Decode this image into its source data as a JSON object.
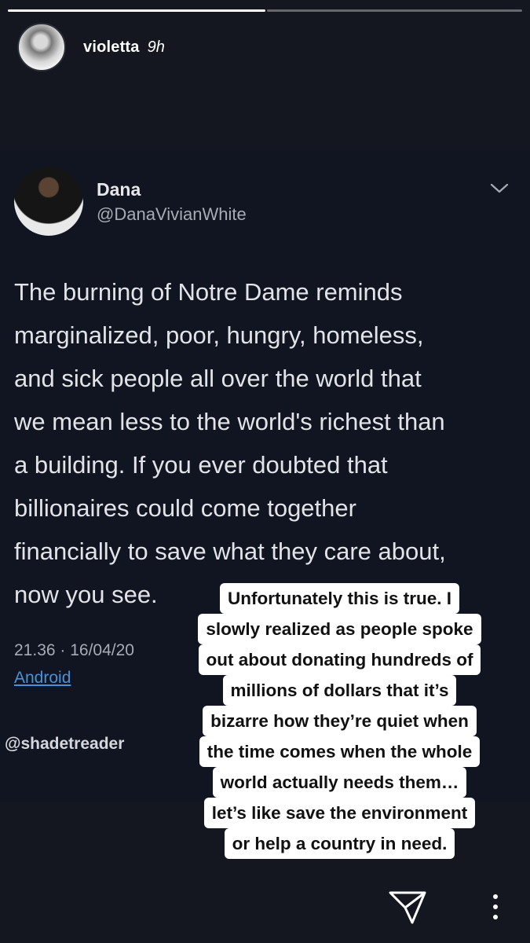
{
  "story": {
    "username": "violetta",
    "time": "9h",
    "progress": [
      1.0,
      0.0
    ]
  },
  "tweet": {
    "name": "Dana",
    "handle": "@DanaVivianWhite",
    "lines": [
      "The burning of Notre Dame reminds",
      "marginalized, poor, hungry, homeless,",
      "and sick people all over the world that",
      "we mean less to the world's richest than",
      "a building. If you ever doubted that",
      "billionaires could come together",
      "financially to save what they care about,",
      "now you see."
    ],
    "meta": "21.36 · 16/04/20",
    "source": "Android",
    "credit": "@shadetreader"
  },
  "caption": {
    "lines": [
      "Unfortunately this is true. I",
      "slowly realized as people spoke",
      "out about donating hundreds of",
      "millions of dollars that it’s",
      "bizarre how they’re quiet when",
      "the time comes when the whole",
      "world actually needs them…",
      "let’s like save the environment",
      "or help a country in need."
    ]
  },
  "icons": {
    "send": "paper-plane-icon",
    "more": "more-vertical-icon",
    "chevron": "chevron-down-icon"
  }
}
